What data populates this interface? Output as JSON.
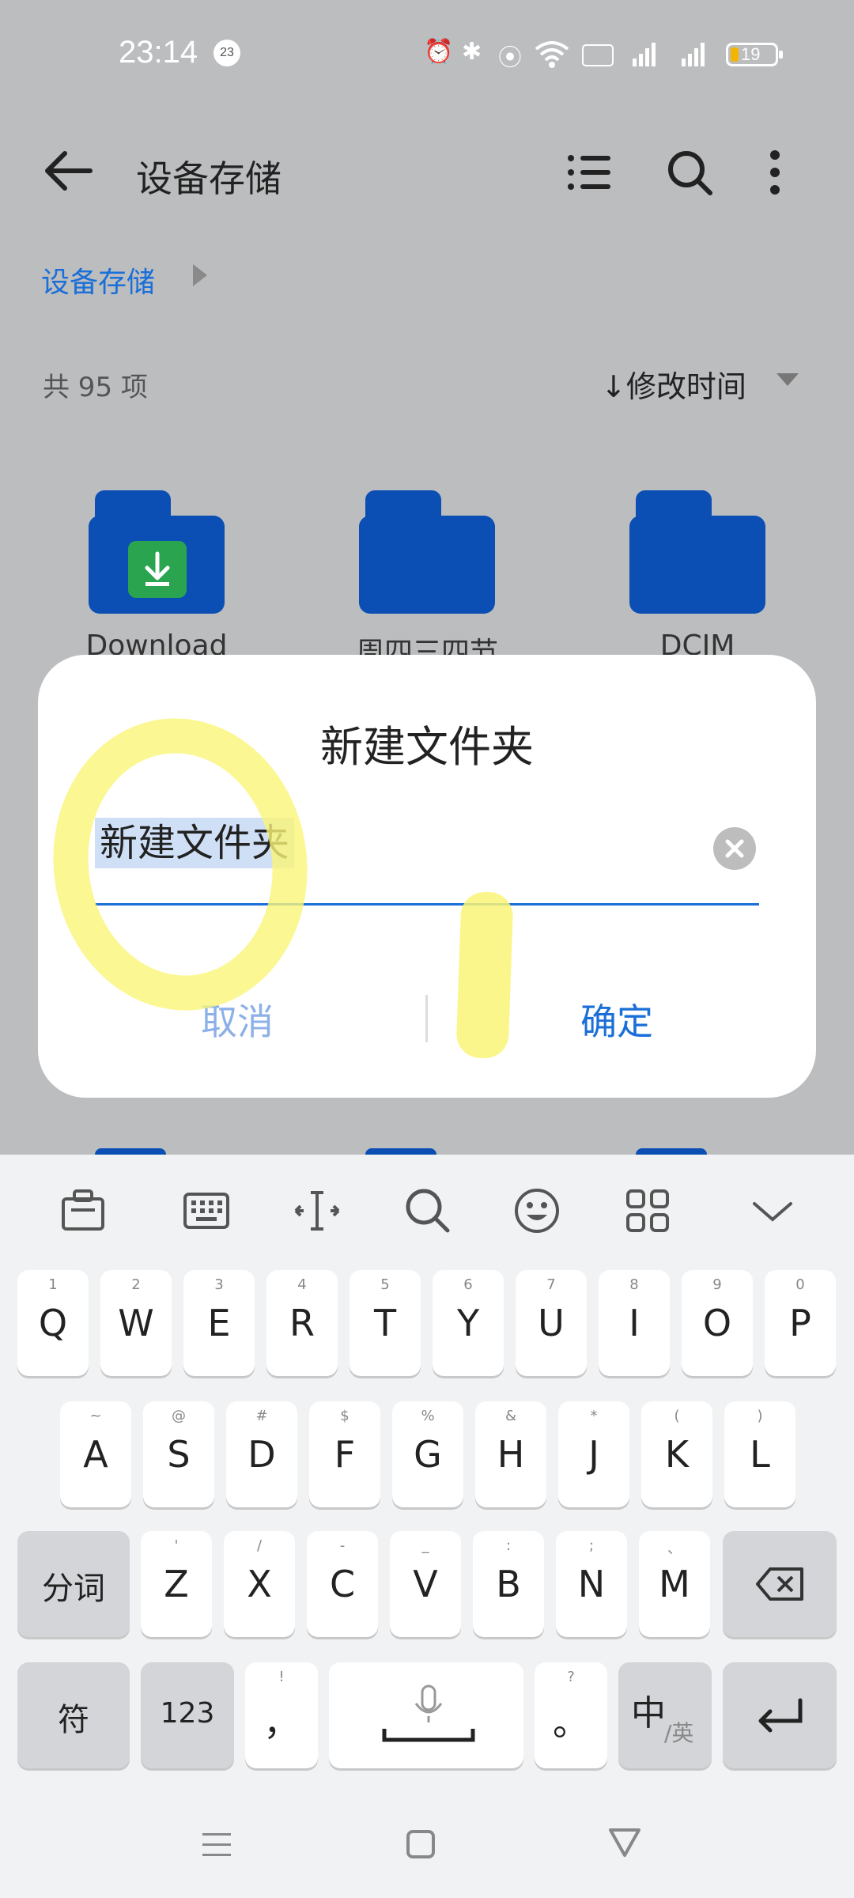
{
  "status_bar": {
    "time": "23:14",
    "badge": "23",
    "battery": "19"
  },
  "app_bar": {
    "title": "设备存储",
    "breadcrumb": "设备存储",
    "count": "共 95 项",
    "sort_label": "↓修改时间"
  },
  "folders": [
    {
      "label": "Download"
    },
    {
      "label": "周四三四节"
    },
    {
      "label": "DCIM"
    }
  ],
  "dialog": {
    "title": "新建文件夹",
    "input_value": "新建文件夹",
    "cancel": "取消",
    "confirm": "确定"
  },
  "keyboard": {
    "row1": [
      {
        "main": "Q",
        "sub": "1"
      },
      {
        "main": "W",
        "sub": "2"
      },
      {
        "main": "E",
        "sub": "3"
      },
      {
        "main": "R",
        "sub": "4"
      },
      {
        "main": "T",
        "sub": "5"
      },
      {
        "main": "Y",
        "sub": "6"
      },
      {
        "main": "U",
        "sub": "7"
      },
      {
        "main": "I",
        "sub": "8"
      },
      {
        "main": "O",
        "sub": "9"
      },
      {
        "main": "P",
        "sub": "0"
      }
    ],
    "row2": [
      {
        "main": "A",
        "sub": "~"
      },
      {
        "main": "S",
        "sub": "@"
      },
      {
        "main": "D",
        "sub": "#"
      },
      {
        "main": "F",
        "sub": "$"
      },
      {
        "main": "G",
        "sub": "%"
      },
      {
        "main": "H",
        "sub": "&"
      },
      {
        "main": "J",
        "sub": "*"
      },
      {
        "main": "K",
        "sub": "("
      },
      {
        "main": "L",
        "sub": ")"
      }
    ],
    "row3": [
      {
        "main": "Z",
        "sub": "'"
      },
      {
        "main": "X",
        "sub": "/"
      },
      {
        "main": "C",
        "sub": "-"
      },
      {
        "main": "V",
        "sub": "_"
      },
      {
        "main": "B",
        "sub": ":"
      },
      {
        "main": "N",
        "sub": ";"
      },
      {
        "main": "M",
        "sub": "、"
      }
    ],
    "fenci": "分词",
    "fu": "符",
    "num": "123",
    "comma": "，",
    "comma_sub": "!",
    "period": "。",
    "period_sub": "?",
    "lang_main": "中",
    "lang_sub": "/英"
  },
  "colors": {
    "accent": "#1a6fd8",
    "folder": "#0b4fb4",
    "download_badge": "#2aa44f",
    "highlight": "#faf578"
  }
}
